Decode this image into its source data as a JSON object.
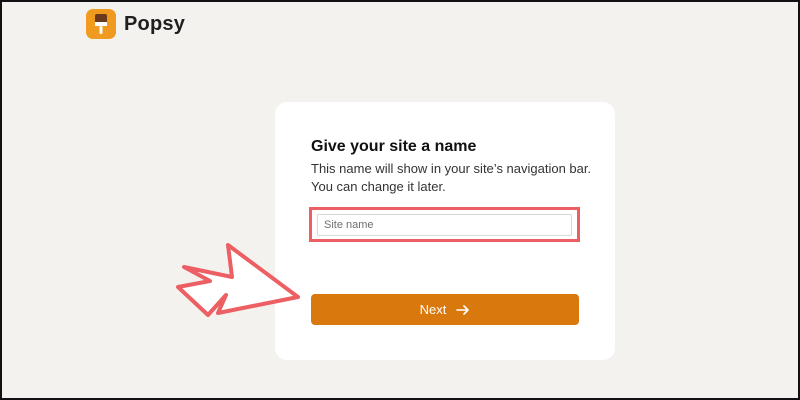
{
  "app": {
    "logo_text": "Popsy",
    "logo_icon": "popsicle-icon",
    "brand_color": "#f09a1f"
  },
  "form": {
    "title": "Give your site a name",
    "description": "This name will show in your site’s navigation bar. You can change it later.",
    "site_name_value": "",
    "site_name_placeholder": "Site name",
    "next_label": "Next",
    "next_icon": "arrow-right-icon",
    "button_color": "#d9780d"
  },
  "annotation": {
    "highlight_color": "#ec5f63",
    "pointer_icon": "pointer-arrow-icon"
  }
}
